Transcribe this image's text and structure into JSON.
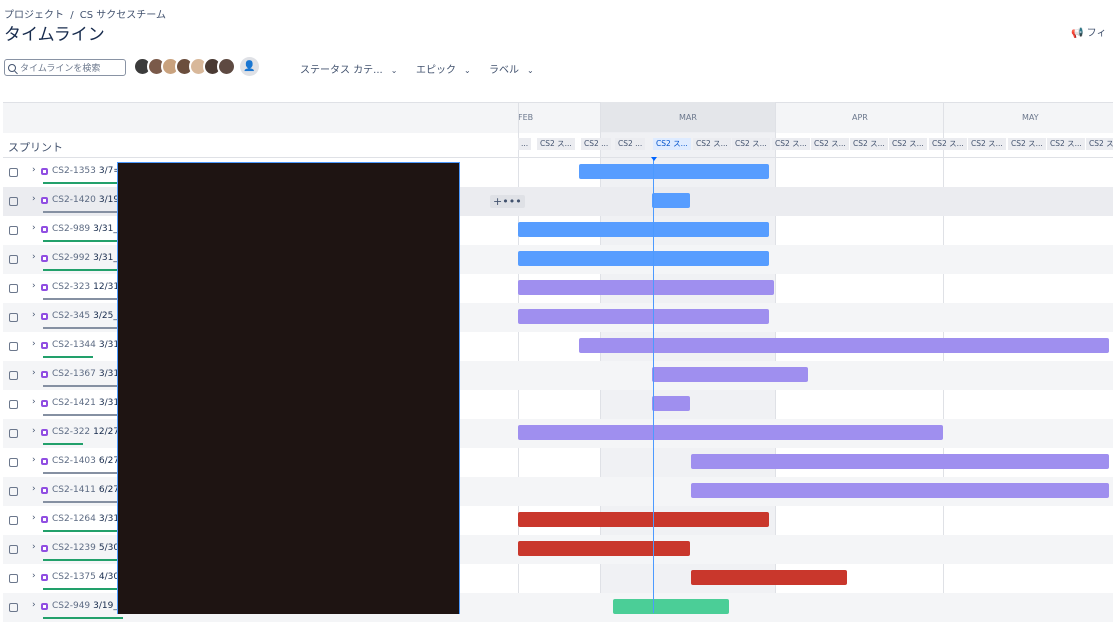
{
  "breadcrumb": [
    "プロジェクト",
    "/",
    "CS サクセスチーム"
  ],
  "page_title": "タイムライン",
  "feedback_label": "フィ",
  "search": {
    "placeholder": "タイムラインを検索"
  },
  "avatars": [
    "#3b3b3b",
    "#7a5a4a",
    "#c9a27e",
    "#6b4e3d",
    "#d8b89a",
    "#4a3a33",
    "#5e4a42"
  ],
  "filters": [
    {
      "label": "ステータス カテ..."
    },
    {
      "label": "エピック"
    },
    {
      "label": "ラベル"
    }
  ],
  "timeline": {
    "sprint_header": "スプリント",
    "months": [
      "FEB",
      "MAR",
      "APR",
      "MAY"
    ],
    "sprints": [
      "...",
      "CS2 ス...",
      "CS2 ...",
      "CS2 ...",
      "CS2 ス...",
      "CS2 ス...",
      "CS2 ス...",
      "CS2 ス...",
      "CS2 ス...",
      "CS2 ス...",
      "CS2 ス...",
      "CS2 ス...",
      "CS2 ス...",
      "CS2 ス...",
      "CS2 ス...",
      "CS2 ス..."
    ],
    "more_button": "+•••"
  },
  "colors": {
    "blue": "#579dff",
    "purple": "#9f8fef",
    "red": "#c9372c",
    "green": "#4bce97",
    "progress_green": "#22a06b",
    "progress_gray": "#8590a2"
  },
  "rows": [
    {
      "key": "CS2-1353",
      "text": "3/7=",
      "color": "blue"
    },
    {
      "key": "CS2-1420",
      "text": "3/19_",
      "color": "blue"
    },
    {
      "key": "CS2-989",
      "text": "3/31_",
      "color": "blue"
    },
    {
      "key": "CS2-992",
      "text": "3/31_",
      "color": "blue"
    },
    {
      "key": "CS2-323",
      "text": "12/31",
      "color": "purple"
    },
    {
      "key": "CS2-345",
      "text": "3/25_",
      "color": "purple"
    },
    {
      "key": "CS2-1344",
      "text": "3/31",
      "color": "purple"
    },
    {
      "key": "CS2-1367",
      "text": "3/31",
      "color": "purple"
    },
    {
      "key": "CS2-1421",
      "text": "3/31",
      "color": "purple"
    },
    {
      "key": "CS2-322",
      "text": "12/27",
      "color": "purple"
    },
    {
      "key": "CS2-1403",
      "text": "6/27",
      "color": "purple"
    },
    {
      "key": "CS2-1411",
      "text": "6/27",
      "color": "purple"
    },
    {
      "key": "CS2-1264",
      "text": "3/31",
      "color": "red"
    },
    {
      "key": "CS2-1239",
      "text": "5/30",
      "color": "red"
    },
    {
      "key": "CS2-1375",
      "text": "4/30",
      "color": "red"
    },
    {
      "key": "CS2-949",
      "text": "3/19_3",
      "color": "green"
    }
  ]
}
